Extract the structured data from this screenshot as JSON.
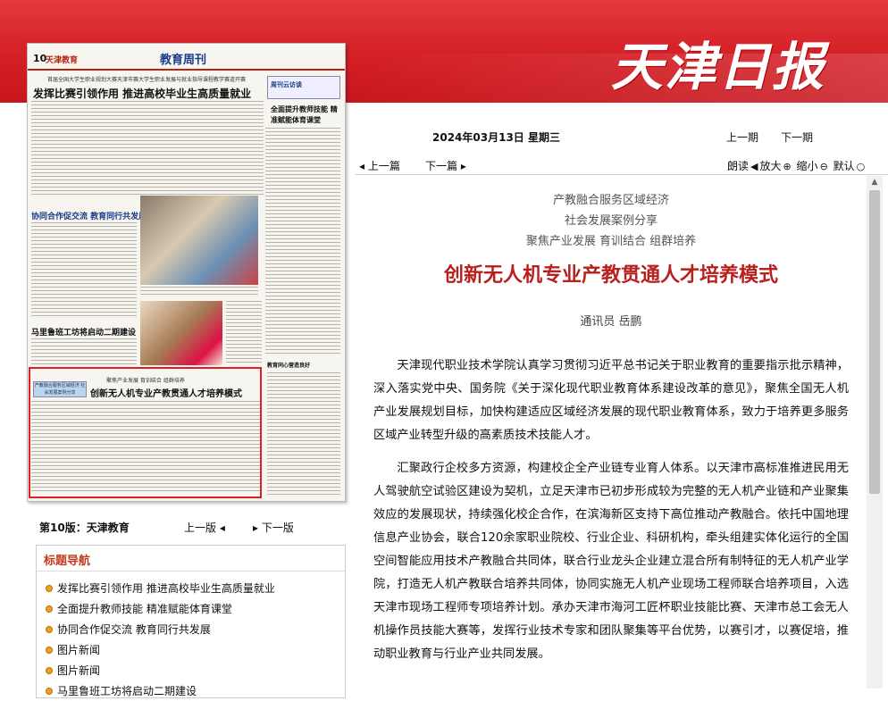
{
  "brand": {
    "logo_text": "天津日报"
  },
  "thumbnail": {
    "page_no": "10",
    "section": "天津教育",
    "weekly": "教育周刊",
    "sub1": "首届全国大学生职业规划大赛天津市赛大学生职业发展与就业指导课程教学赛道开赛",
    "headline1": "发挥比赛引领作用  推进高校毕业生高质量就业",
    "side_tag": "周刊云访谈",
    "side_headline": "全面提升教师技能 精准赋能体育课堂",
    "headline2": "协同合作促交流  教育同行共发展",
    "headline3": "马里鲁班工坊将启动二期建设",
    "caption": "教育同心营造良好",
    "tag": "产教融合服务区域经济 社会发展案例分享",
    "article_kicker": "聚焦产业发展  育训结合  组群培养",
    "article_title": "创新无人机专业产教贯通人才培养模式"
  },
  "page_info": {
    "label": "第10版：",
    "name": "天津教育",
    "prev": "上一版",
    "next": "下一版"
  },
  "nav": {
    "title": "标题导航",
    "items": [
      "发挥比赛引领作用  推进高校毕业生高质量就业",
      "全面提升教师技能  精准赋能体育课堂",
      "协同合作促交流  教育同行共发展",
      "图片新闻",
      "图片新闻",
      "马里鲁班工坊将启动二期建设"
    ]
  },
  "toolbar": {
    "date": "2024年03月13日  星期三",
    "prev_issue": "上一期",
    "next_issue": "下一期",
    "prev_article": "上一篇",
    "next_article": "下一篇",
    "read": "朗读",
    "zoom_in": "放大",
    "zoom_out": "缩小",
    "default": "默认"
  },
  "article": {
    "kicker1": "产教融合服务区域经济",
    "kicker2": "社会发展案例分享",
    "kicker3": "聚焦产业发展  育训结合  组群培养",
    "title": "创新无人机专业产教贯通人才培养模式",
    "author": "通讯员  岳鹏",
    "p1": "天津现代职业技术学院认真学习贯彻习近平总书记关于职业教育的重要指示批示精神，深入落实党中央、国务院《关于深化现代职业教育体系建设改革的意见》，聚焦全国无人机产业发展规划目标，加快构建适应区域经济发展的现代职业教育体系，致力于培养更多服务区域产业转型升级的高素质技术技能人才。",
    "p2": "汇聚政行企校多方资源，构建校企全产业链专业育人体系。以天津市高标准推进民用无人驾驶航空试验区建设为契机，立足天津市已初步形成较为完整的无人机产业链和产业聚集效应的发展现状，持续强化校企合作，在滨海新区支持下高位推动产教融合。依托中国地理信息产业协会，联合120余家职业院校、行业企业、科研机构，牵头组建实体化运行的全国空间智能应用技术产教融合共同体，联合行业龙头企业建立混合所有制特征的无人机产业学院，打造无人机产教联合培养共同体，协同实施无人机产业现场工程师联合培养项目，入选天津市现场工程师专项培养计划。承办天津市海河工匠杯职业技能比赛、天津市总工会无人机操作员技能大赛等，发挥行业技术专家和团队聚集等平台优势，以赛引才，以赛促培，推动职业教育与行业产业共同发展。"
  }
}
